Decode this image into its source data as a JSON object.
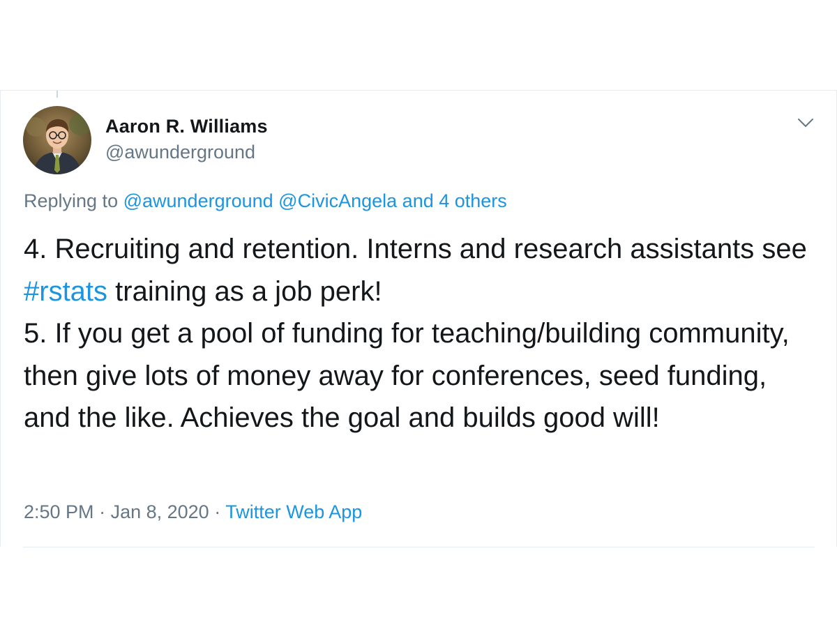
{
  "author": {
    "name": "Aaron R. Williams",
    "handle": "@awunderground"
  },
  "menu_icon": "chevron-down-icon",
  "reply": {
    "prefix": "Replying to ",
    "mention_1": "@awunderground",
    "mention_2": "@CivicAngela",
    "others": "and 4 others"
  },
  "tweet": {
    "line1_a": "4. Recruiting and retention. Interns and research assistants see ",
    "hashtag": "#rstats",
    "line1_b": " training as a job perk!",
    "line2": "5. If you get a pool of funding for teaching/building community, then give lots of money away for conferences, seed funding, and the like. Achieves the goal and builds good will!"
  },
  "meta": {
    "time": "2:50 PM",
    "sep1": " · ",
    "date": "Jan 8, 2020",
    "sep2": " · ",
    "source": "Twitter Web App"
  },
  "colors": {
    "link": "#1b95e0",
    "secondary_text": "#657786",
    "primary_text": "#14171a",
    "border": "#e6ecf0"
  }
}
